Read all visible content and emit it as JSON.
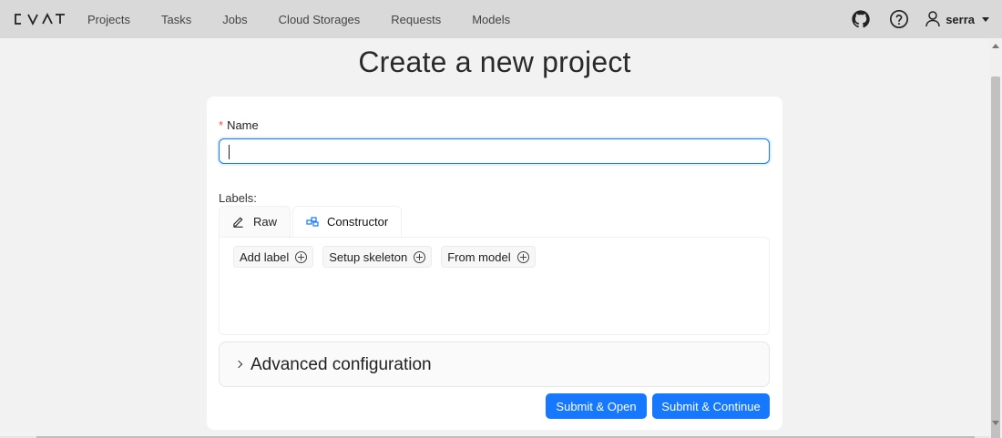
{
  "header": {
    "logo_text": "CVAT",
    "nav": [
      "Projects",
      "Tasks",
      "Jobs",
      "Cloud Storages",
      "Requests",
      "Models"
    ],
    "icons": [
      "github-icon",
      "help-icon",
      "user-icon"
    ],
    "username": "serra"
  },
  "page": {
    "title": "Create a new project"
  },
  "form": {
    "name_required_mark": "*",
    "name_label": "Name",
    "name_value": "",
    "labels_label": "Labels:",
    "tabs": [
      {
        "label": "Raw",
        "icon": "edit-icon",
        "active": false
      },
      {
        "label": "Constructor",
        "icon": "build-icon",
        "active": true
      }
    ],
    "constructor_buttons": [
      "Add label",
      "Setup skeleton",
      "From model"
    ],
    "advanced_title": "Advanced configuration",
    "submit_open": "Submit & Open",
    "submit_continue": "Submit & Continue"
  },
  "colors": {
    "primary": "#1677ff",
    "required": "#ff4d4f",
    "header_bg": "#d9d9d9",
    "page_bg": "#f2f2f2"
  }
}
